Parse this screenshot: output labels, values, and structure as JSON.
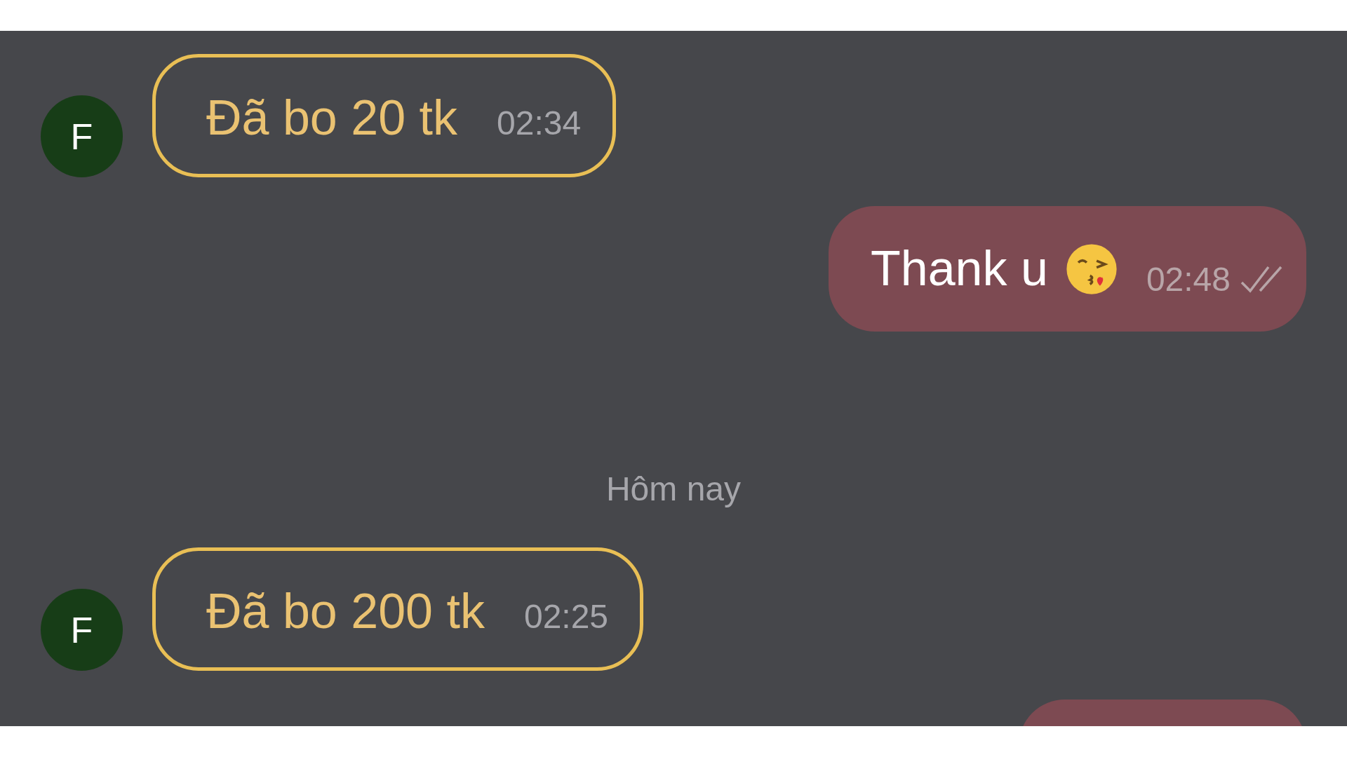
{
  "messages": [
    {
      "kind": "incoming",
      "avatar": "F",
      "text": "Đã bo 20 tk",
      "time": "02:34"
    },
    {
      "kind": "outgoing",
      "text": "Thank u",
      "emoji": true,
      "time": "02:48",
      "read": true
    },
    {
      "kind": "date",
      "text": "Hôm nay"
    },
    {
      "kind": "incoming",
      "avatar": "F",
      "text": "Đã bo 200 tk",
      "time": "02:25"
    },
    {
      "kind": "cut-bubble"
    }
  ]
}
